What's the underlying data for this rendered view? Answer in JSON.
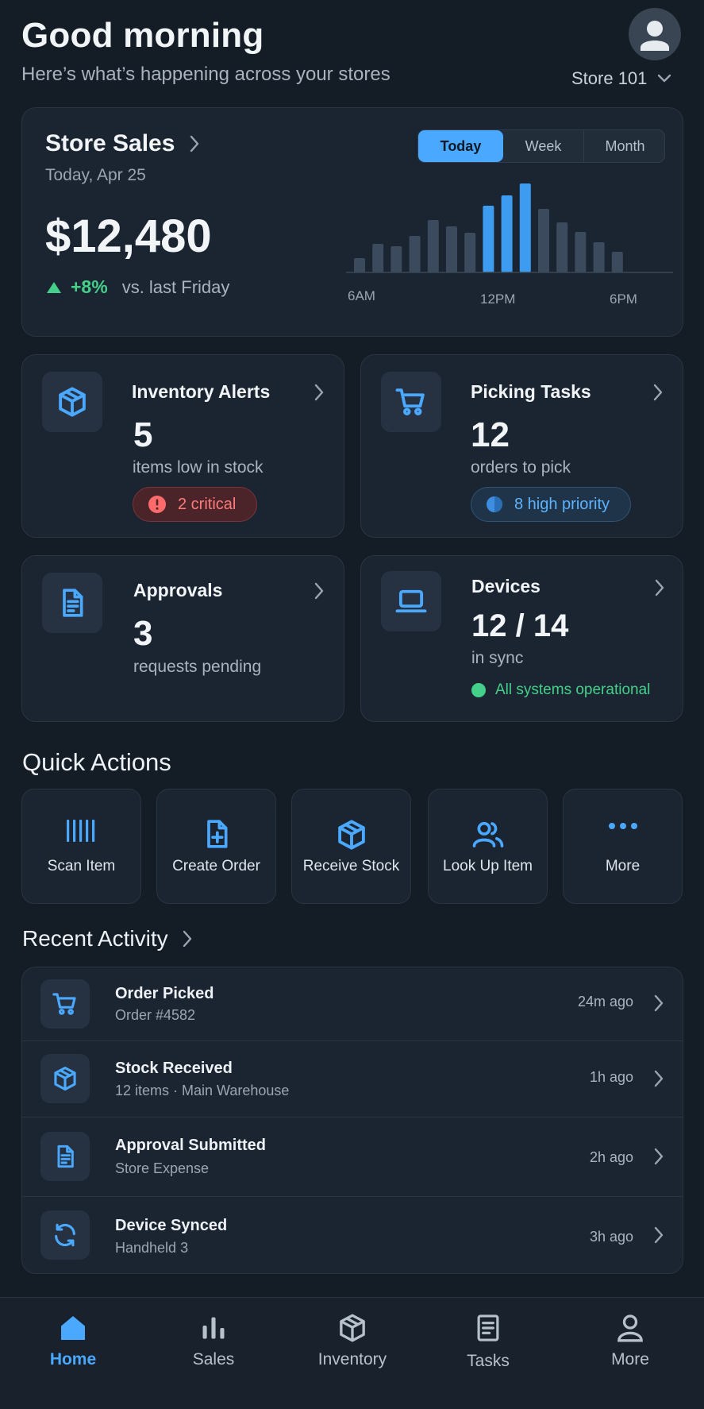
{
  "header": {
    "greeting": "Good morning",
    "subtitle": "Here’s what’s happening across your stores",
    "store_selector": "Store 101"
  },
  "sales": {
    "title": "Store Sales",
    "date": "Today, Apr 25",
    "amount": "$12,480",
    "change": "+8%",
    "comparison": "vs. last Friday",
    "tabs": [
      "Today",
      "Week",
      "Month"
    ],
    "active_tab": "Today"
  },
  "chart_data": {
    "type": "bar",
    "title": "",
    "tick_labels": [
      "6AM",
      "12PM",
      "6PM"
    ],
    "values": [
      18,
      36,
      33,
      46,
      66,
      58,
      50,
      84,
      97,
      112,
      80,
      63,
      51,
      38,
      26
    ],
    "highlighted": [
      7,
      8,
      9
    ],
    "colors": {
      "normal": "#3b4a5c",
      "highlight": "#3d9cf0"
    }
  },
  "cards": {
    "inventory": {
      "title": "Inventory Alerts",
      "value": "5",
      "caption": "items low in stock",
      "badge": "2 critical"
    },
    "picking": {
      "title": "Picking Tasks",
      "value": "12",
      "caption": "orders to pick",
      "badge": "8 high priority"
    },
    "approvals": {
      "title": "Approvals",
      "value": "3",
      "caption": "requests pending"
    },
    "devices": {
      "title": "Devices",
      "value": "12 / 14",
      "caption": "in sync",
      "status": "All systems operational"
    }
  },
  "quick_actions": {
    "title": "Quick Actions",
    "items": [
      "Scan Item",
      "Create Order",
      "Receive Stock",
      "Look Up Item",
      "More"
    ]
  },
  "activity": {
    "title": "Recent Activity",
    "items": [
      {
        "title": "Order Picked",
        "sub": "Order #4582",
        "time": "24m ago"
      },
      {
        "title": "Stock Received",
        "sub": "12 items · Main Warehouse",
        "time": "1h ago"
      },
      {
        "title": "Approval Submitted",
        "sub": "Store Expense",
        "time": "2h ago"
      },
      {
        "title": "Device Synced",
        "sub": "Handheld 3",
        "time": "3h ago"
      }
    ]
  },
  "nav": {
    "items": [
      "Home",
      "Sales",
      "Inventory",
      "Tasks",
      "More"
    ],
    "active": "Home"
  },
  "colors": {
    "background": "#141c26",
    "card": "#1b2531",
    "accent": "#4aa8ff",
    "positive": "#44d08a",
    "critical": "#ff6b6b"
  }
}
